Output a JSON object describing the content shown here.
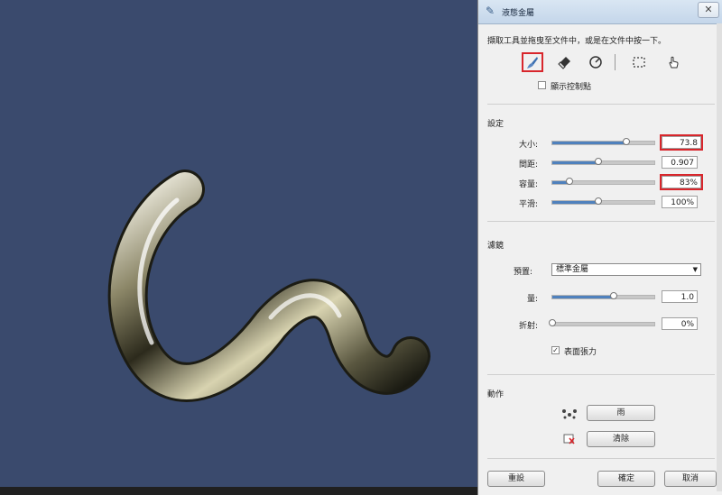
{
  "window": {
    "title": "液態金屬",
    "close": "✕"
  },
  "hint": "擷取工具並拖曳至文件中，或是在文件中按一下。",
  "tools": [
    "brush-tool",
    "eraser-tool",
    "smooth-tool",
    "marquee-tool",
    "hand-tool"
  ],
  "show_control_points": {
    "label": "顯示控制點",
    "checked": false
  },
  "settings": {
    "title": "設定",
    "rows": [
      {
        "label": "大小:",
        "value": "73.8",
        "level": 0.73
      },
      {
        "label": "間距:",
        "value": "0.907",
        "level": 0.45
      },
      {
        "label": "容量:",
        "value": "83%",
        "level": 0.17
      },
      {
        "label": "平滑:",
        "value": "100%",
        "level": 0.45
      }
    ]
  },
  "render": {
    "title": "濾鏡",
    "preset_label": "預置:",
    "preset_value": "標準金屬",
    "rows": [
      {
        "label": "量:",
        "value": "1.0",
        "level": 0.6
      },
      {
        "label": "折射:",
        "value": "0%",
        "level": 0.0
      }
    ],
    "surface_tension": {
      "label": "表面張力",
      "checked": true
    }
  },
  "actions": {
    "title": "動作",
    "rain_button": "雨",
    "clear_button": "清除"
  },
  "footer": {
    "reset": "重設",
    "ok": "確定",
    "cancel": "取消"
  },
  "colors": {
    "canvas": "#3a4a6d",
    "highlight": "#d8262c",
    "slider": "#4f81bd"
  }
}
